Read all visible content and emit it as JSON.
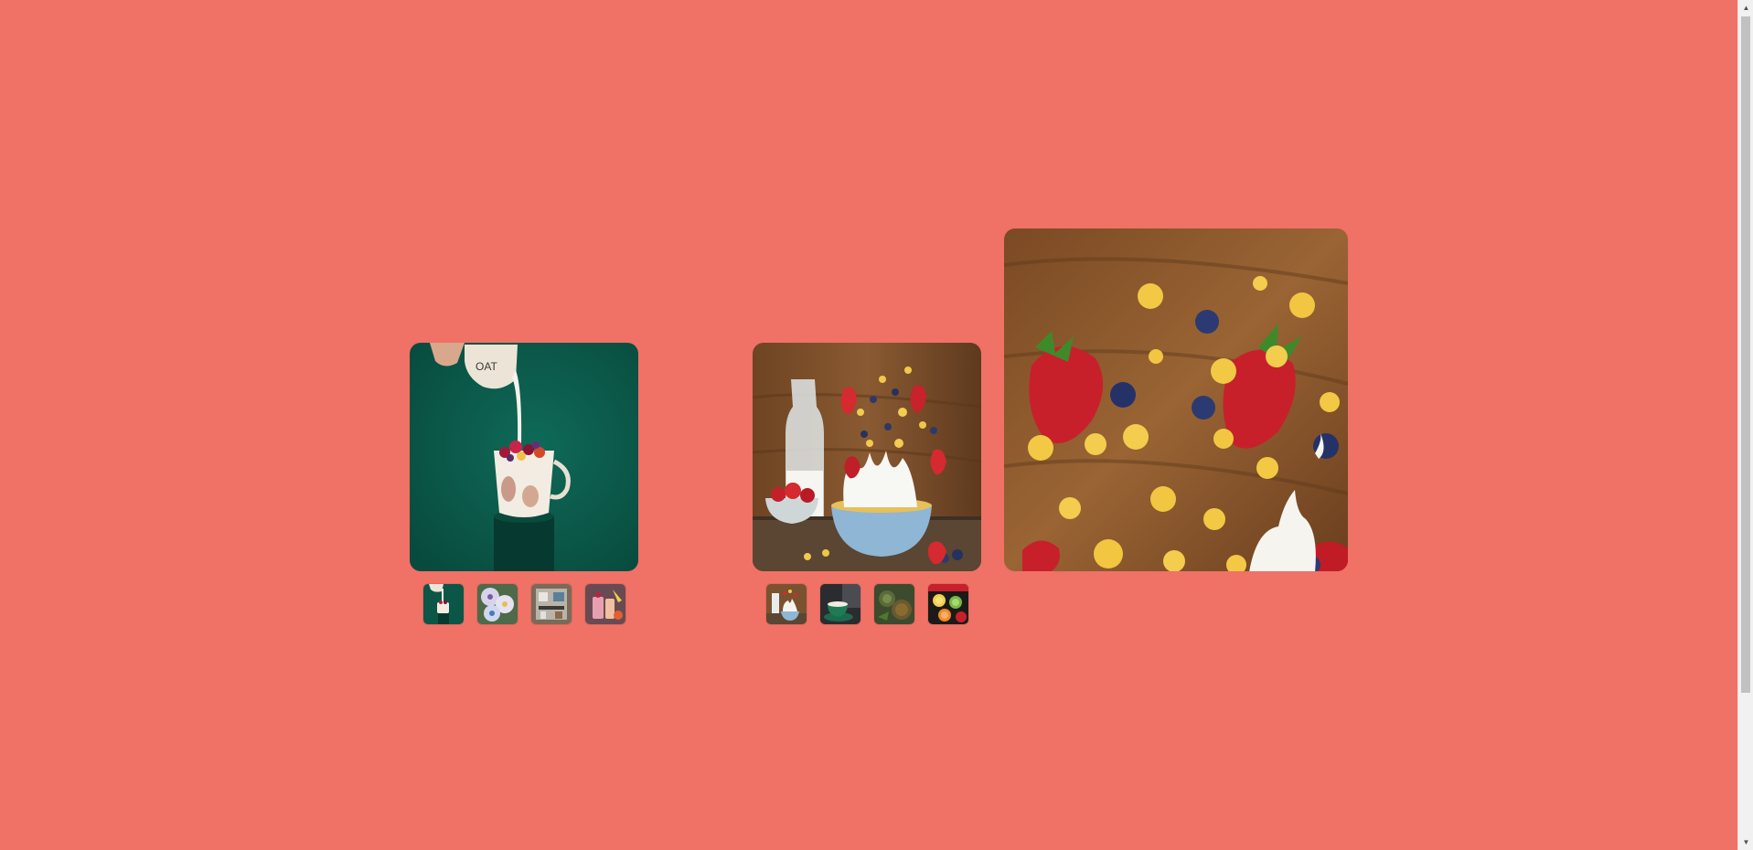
{
  "page": {
    "background_color": "#f07166"
  },
  "gallery_left": {
    "main_image": "milk-pouring-cereal-mug-image",
    "thumbnails": [
      "milk-pouring-cereal-mug-thumbnail",
      "yogurt-bowls-thumbnail",
      "kitchen-shelf-thumbnail",
      "fruit-smoothie-thumbnail"
    ],
    "active_thumbnail_index": 0
  },
  "gallery_right": {
    "main_image": "cornflakes-splash-bowl-image",
    "enlarged_preview": "cornflakes-strawberries-closeup-image",
    "thumbnails": [
      "cornflakes-splash-bowl-thumbnail",
      "green-coffee-cup-thumbnail",
      "herbal-tea-thumbnail",
      "fruit-slices-thumbnail"
    ],
    "active_thumbnail_index": 0
  },
  "scrollbar": {
    "up_arrow_icon": "chevron-up-icon",
    "down_arrow_icon": "chevron-down-icon",
    "up_glyph": "▲",
    "down_glyph": "▼"
  }
}
